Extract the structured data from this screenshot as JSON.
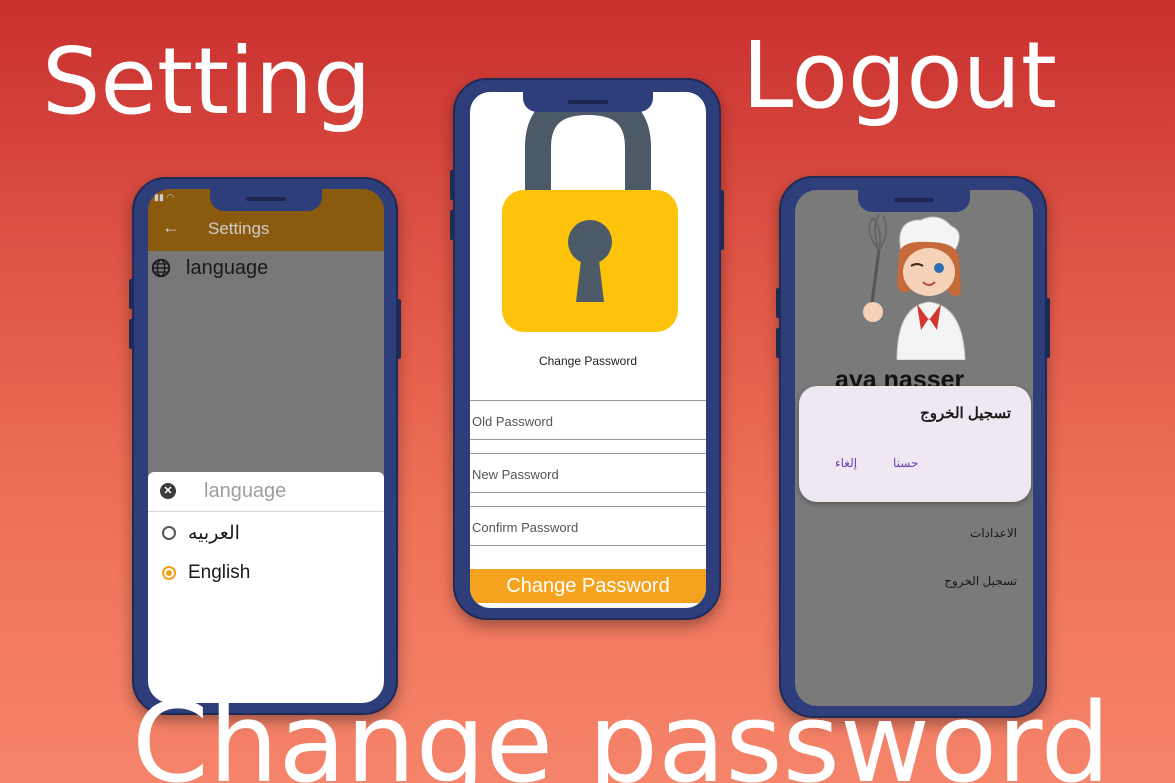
{
  "headings": {
    "setting": "Setting",
    "logout": "Logout",
    "change_password": "Change password"
  },
  "settings_screen": {
    "app_bar_title": "Settings",
    "row_label": "language",
    "sheet": {
      "search_placeholder": "language",
      "options": [
        {
          "label": "العربيه",
          "selected": false
        },
        {
          "label": "English",
          "selected": true
        }
      ]
    },
    "colors": {
      "app_bar": "#8a5a0e",
      "radio_selected": "#f0a21a"
    }
  },
  "password_screen": {
    "title": "Change Password",
    "fields": {
      "old_placeholder": "Old Password",
      "new_placeholder": "New Password",
      "confirm_placeholder": "Confirm Password"
    },
    "button_label": "Change Password",
    "colors": {
      "button": "#f5a21e",
      "lock_body": "#fcc30a",
      "lock_shackle": "#4b5a66"
    }
  },
  "logout_screen": {
    "user_name": "aya nasser",
    "dialog": {
      "title": "تسجيل الخروج",
      "cancel_label": "إلغاء",
      "ok_label": "حسنا"
    },
    "drawer": {
      "settings_label": "الاعدادات",
      "logout_label": "تسجيل الخروج"
    }
  }
}
